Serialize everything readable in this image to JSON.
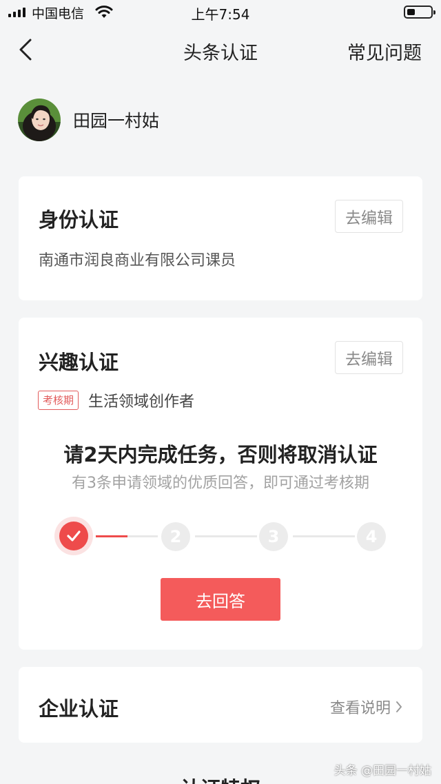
{
  "status_bar": {
    "carrier": "中国电信",
    "time": "上午7:54",
    "battery_level": 0.35
  },
  "nav": {
    "title": "头条认证",
    "faq": "常见问题"
  },
  "profile": {
    "name": "田园一村姑"
  },
  "identity": {
    "title": "身份认证",
    "edit_label": "去编辑",
    "description": "南通市润良商业有限公司课员"
  },
  "interest": {
    "title": "兴趣认证",
    "edit_label": "去编辑",
    "tag": "考核期",
    "domain": "生活领域创作者",
    "task_title": "请2天内完成任务，否则将取消认证",
    "task_subtitle": "有3条申请领域的优质回答，即可通过考核期",
    "steps": [
      "1",
      "2",
      "3",
      "4"
    ],
    "completed_steps": 1,
    "answer_button": "去回答"
  },
  "enterprise": {
    "title": "企业认证",
    "link_label": "查看说明"
  },
  "next_section": {
    "title": "认证特权"
  },
  "watermark": "头条 @田园一村姑",
  "colors": {
    "accent": "#f45b5b",
    "background": "#f4f5f6",
    "card": "#ffffff"
  }
}
